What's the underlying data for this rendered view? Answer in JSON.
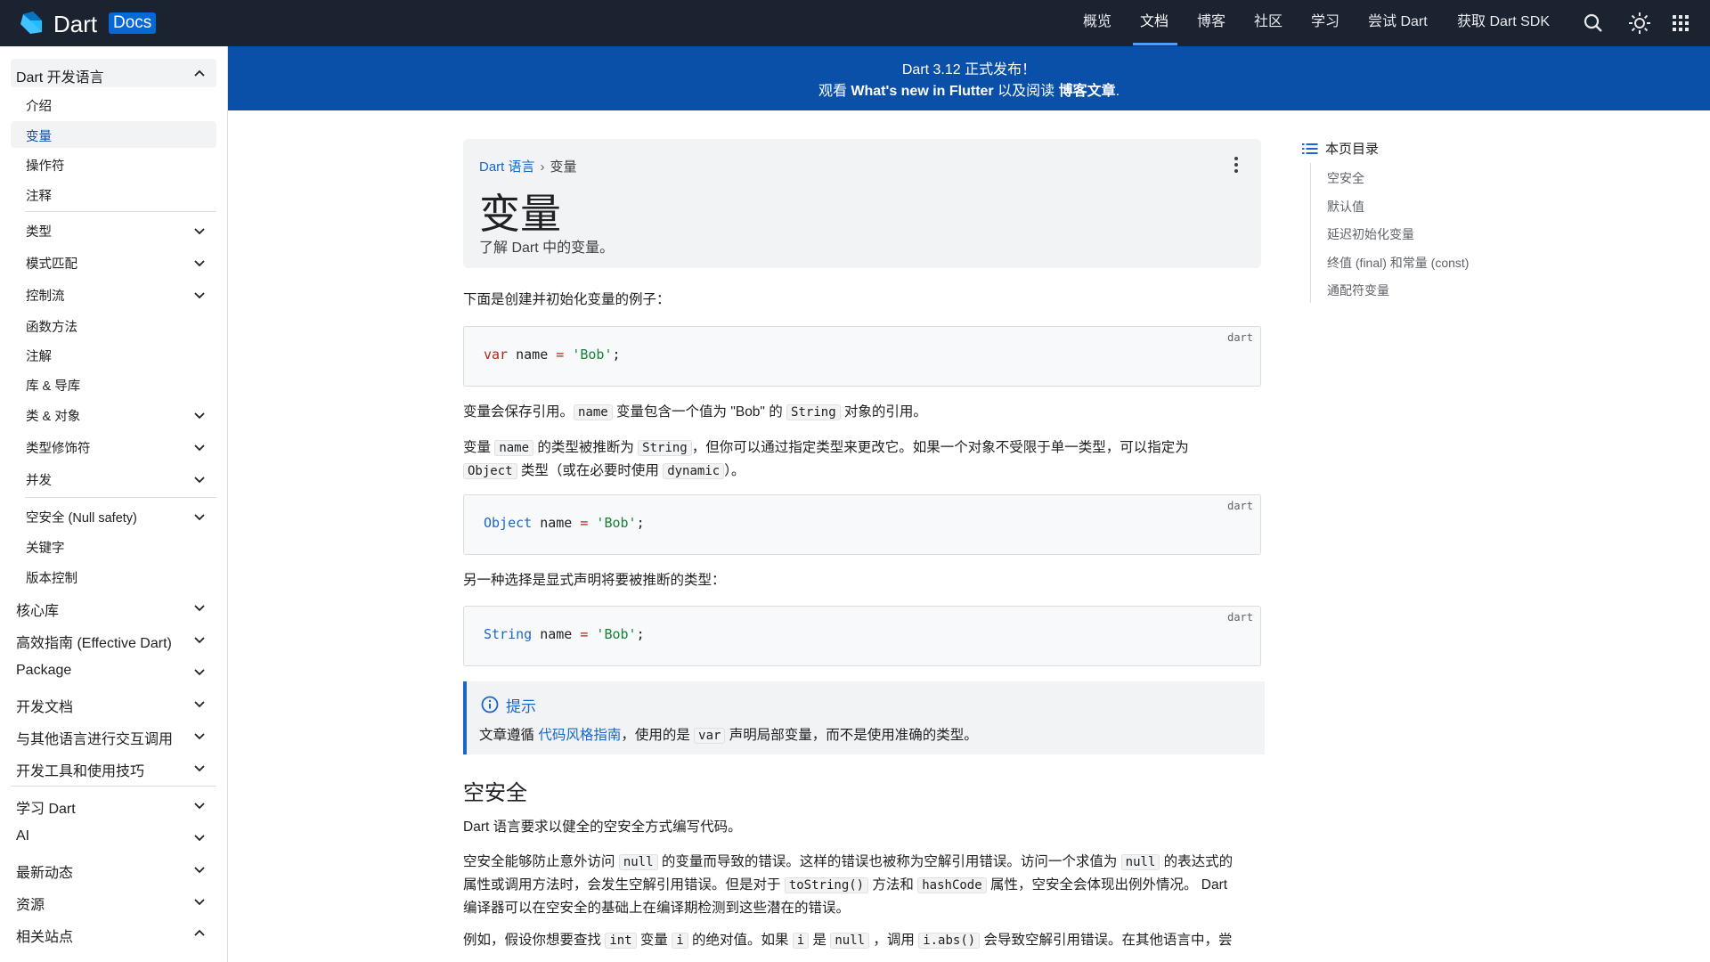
{
  "topnav": {
    "brand": "Dart",
    "brand_badge": "Docs",
    "links": [
      "概览",
      "文档",
      "博客",
      "社区",
      "学习",
      "尝试 Dart",
      "获取 Dart SDK"
    ],
    "active_link": "文档",
    "icons": [
      "search-icon",
      "theme-toggle-icon",
      "apps-grid-icon"
    ]
  },
  "banner": {
    "line1": "Dart 3.12 正式发布！",
    "line2_prefix": "观看 ",
    "line2_link1": "What's new in Flutter",
    "line2_mid": " 以及阅读 ",
    "line2_link2": "博客文章",
    "line2_suffix": "."
  },
  "sidebar": {
    "section_title": "Dart 开发语言",
    "group1": [
      "介绍",
      "变量",
      "操作符",
      "注释"
    ],
    "active_item": "变量",
    "group2": [
      "类型",
      "模式匹配",
      "控制流",
      "函数方法",
      "注解",
      "库 & 导库",
      "类 & 对象",
      "类型修饰符",
      "并发"
    ],
    "group3": [
      "空安全 (Null safety)",
      "关键字",
      "版本控制"
    ],
    "top_sections": [
      "核心库",
      "高效指南 (Effective Dart)",
      "Package",
      "开发文档",
      "与其他语言进行交互调用",
      "开发工具和使用技巧"
    ],
    "bottom_sections": [
      "学习 Dart",
      "AI",
      "最新动态",
      "资源",
      "相关站点"
    ]
  },
  "article": {
    "breadcrumb_parent": "Dart 语言",
    "breadcrumb_current": "变量",
    "title": "变量",
    "subtitle": "了解 Dart 中的变量。",
    "p1": "下面是创建并初始化变量的例子：",
    "code1": {
      "lang": "dart",
      "kw": "var",
      "rest": " name ",
      "op": "=",
      "str": " 'Bob'",
      "end": ";"
    },
    "p2_a": "变量会保存引用。",
    "p2_code1": "name",
    "p2_b": " 变量包含一个值为 \"Bob\" 的 ",
    "p2_code2": "String",
    "p2_c": " 对象的引用。",
    "p3_a": "变量 ",
    "p3_code1": "name",
    "p3_b": " 的类型被推断为 ",
    "p3_code2": "String",
    "p3_c": "，但你可以通过指定类型来更改它。如果一个对象不受限于单一类型，可以指定为",
    "p3_code3": "Object",
    "p3_d": " 类型（或在必要时使用 ",
    "p3_code4": "dynamic",
    "p3_e": "）。",
    "code2": {
      "lang": "dart",
      "ty": "Object",
      "rest": " name ",
      "op": "=",
      "str": " 'Bob'",
      "end": ";"
    },
    "p4": "另一种选择是显式声明将要被推断的类型：",
    "code3": {
      "lang": "dart",
      "ty": "String",
      "rest": " name ",
      "op": "=",
      "str": " 'Bob'",
      "end": ";"
    },
    "tip": {
      "title": "提示",
      "body_a": "文章遵循 ",
      "body_link": "代码风格指南",
      "body_b": "，使用的是 ",
      "body_code": "var",
      "body_c": " 声明局部变量，而不是使用准确的类型。"
    },
    "h2": "空安全",
    "p5": "Dart 语言要求以健全的空安全方式编写代码。",
    "p6_a": "空安全能够防止意外访问 ",
    "p6_code1": "null",
    "p6_b": " 的变量而导致的错误。这样的错误也被称为空解引用错误。访问一个求值为 ",
    "p6_code2": "null",
    "p6_c": " 的表达式的",
    "p6_d": "属性或调用方法时，会发生空解引用错误。但是对于 ",
    "p6_code3": "toString()",
    "p6_e": " 方法和 ",
    "p6_code4": "hashCode",
    "p6_f": " 属性，空安全会体现出例外情况。 Dart",
    "p6_g": "编译器可以在空安全的基础上在编译期检测到这些潜在的错误。",
    "p7_a": "例如，假设你想要查找 ",
    "p7_code1": "int",
    "p7_b": " 变量 ",
    "p7_code2": "i",
    "p7_c": " 的绝对值。如果 ",
    "p7_code3": "i",
    "p7_d": " 是 ",
    "p7_code4": "null",
    "p7_e": " ，调用 ",
    "p7_code5": "i.abs()",
    "p7_f": " 会导致空解引用错误。在其他语言中，尝"
  },
  "toc": {
    "title": "本页目录",
    "items": [
      "空安全",
      "默认值",
      "延迟初始化变量",
      "终值 (final) 和常量 (const)",
      "通配符变量"
    ]
  },
  "colors": {
    "nav_bg": "#1b2230",
    "banner_bg": "#0a4fa8",
    "link": "#1a66c9",
    "badge": "#0468d7"
  }
}
